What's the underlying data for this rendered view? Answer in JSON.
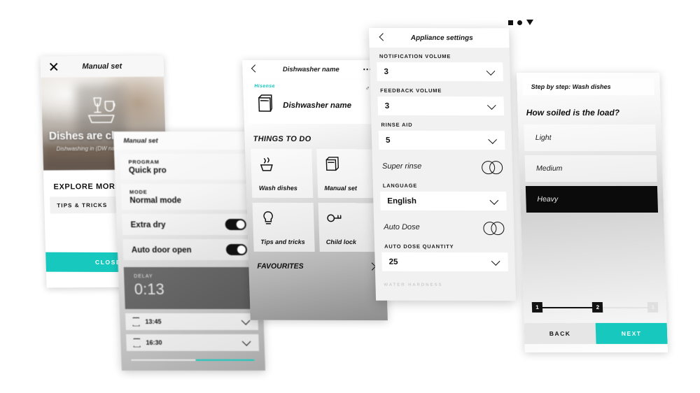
{
  "app": {
    "brand": "Hisense",
    "accent_color": "#16c8bd",
    "dark_color": "#0b0b0b"
  },
  "decor": {
    "square_icon": "square-icon",
    "circle_icon": "circle-icon",
    "triangle_icon": "triangle-down-icon"
  },
  "screen_clean": {
    "header_title": "Manual set",
    "close_icon": "close-icon",
    "hero_title": "Dishes are clean now.",
    "hero_subtitle": "Dishwashing in (DW name) is finished.",
    "hero_icon": "clean-dishes-icon",
    "explore_label": "EXPLORE MORE",
    "tips_label": "TIPS & TRICKS",
    "tips_chevron": "chevron-right-icon",
    "close_button": "CLOSE"
  },
  "screen_manual": {
    "header_title": "Manual set",
    "rows": [
      {
        "label": "PROGRAM",
        "value": "Quick pro",
        "type": "value"
      },
      {
        "label": "MODE",
        "value": "Normal mode",
        "type": "value"
      },
      {
        "label": "Extra dry",
        "value": "",
        "type": "toggle",
        "state": "on"
      },
      {
        "label": "Auto door open",
        "value": "",
        "type": "toggle",
        "state": "on"
      }
    ],
    "timer_caption": "DELAY",
    "timer_value": "0:13",
    "time_rows": [
      {
        "icon": "hourglass-icon",
        "value": "13:45",
        "chevron": "chevron-down-icon"
      },
      {
        "icon": "hourglass-icon",
        "value": "16:30",
        "chevron": "chevron-down-icon"
      }
    ],
    "progress_percent": 48
  },
  "screen_device": {
    "header_title": "Dishwasher name",
    "back_icon": "chevron-left-icon",
    "more_icon": "more-options-icon",
    "brand_label": "Hisense",
    "device_name": "Dishwasher name",
    "device_icon": "dishwasher-icon",
    "status_icon": "connected-icon",
    "section_title": "THINGS TO DO",
    "tiles": [
      {
        "label": "Wash dishes",
        "icon": "wash-dishes-icon"
      },
      {
        "label": "Manual set",
        "icon": "manual-set-icon"
      },
      {
        "label": "Tips and tricks",
        "icon": "tips-icon"
      },
      {
        "label": "Child lock",
        "icon": "child-lock-key-icon"
      }
    ],
    "favourites_label": "FAVOURITES",
    "favourites_chevron": "chevron-right-icon"
  },
  "screen_settings": {
    "header_title": "Appliance settings",
    "back_icon": "chevron-left-icon",
    "fields": [
      {
        "label": "NOTIFICATION VOLUME",
        "value": "3",
        "type": "select"
      },
      {
        "label": "FEEDBACK VOLUME",
        "value": "3",
        "type": "select"
      },
      {
        "label": "RINSE AID",
        "value": "5",
        "type": "select"
      },
      {
        "label": "Super rinse",
        "value": "",
        "type": "toggle",
        "state": "off"
      },
      {
        "label": "LANGUAGE",
        "value": "English",
        "type": "select"
      },
      {
        "label": "Auto Dose",
        "value": "",
        "type": "toggle",
        "state": "off"
      },
      {
        "label": "AUTO DOSE QUANTITY",
        "value": "25",
        "type": "select"
      }
    ],
    "footer_hint": "WATER HARDNESS"
  },
  "screen_steps": {
    "header_title": "Step by step: Wash dishes",
    "question": "How soiled is the load?",
    "options": [
      {
        "label": "Light",
        "selected": false
      },
      {
        "label": "Medium",
        "selected": false
      },
      {
        "label": "Heavy",
        "selected": true
      }
    ],
    "steps": [
      {
        "number": "1",
        "active": true
      },
      {
        "number": "2",
        "active": true
      },
      {
        "number": "3",
        "active": false
      }
    ],
    "back_button": "BACK",
    "next_button": "NEXT"
  }
}
